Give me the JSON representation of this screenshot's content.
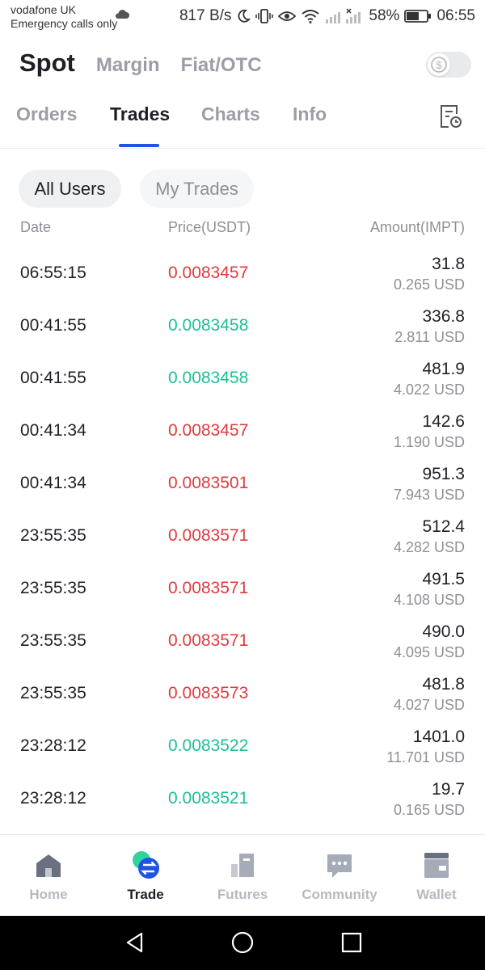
{
  "status_bar": {
    "carrier": "vodafone UK",
    "emergency": "Emergency calls only",
    "speed": "817 B/s",
    "battery": "58%",
    "time": "06:55"
  },
  "top_tabs": [
    "Spot",
    "Margin",
    "Fiat/OTC"
  ],
  "toggle_icon": "dollar-icon",
  "sub_tabs": [
    "Orders",
    "Trades",
    "Charts",
    "Info"
  ],
  "filters": {
    "all": "All Users",
    "mine": "My Trades"
  },
  "table": {
    "headers": {
      "date": "Date",
      "price": "Price(USDT)",
      "amount": "Amount(IMPT)"
    },
    "rows": [
      {
        "time": "06:55:15",
        "price": "0.0083457",
        "amount": "31.8",
        "usd": "0.265 USD",
        "side": "down"
      },
      {
        "time": "00:41:55",
        "price": "0.0083458",
        "amount": "336.8",
        "usd": "2.811 USD",
        "side": "up"
      },
      {
        "time": "00:41:55",
        "price": "0.0083458",
        "amount": "481.9",
        "usd": "4.022 USD",
        "side": "up"
      },
      {
        "time": "00:41:34",
        "price": "0.0083457",
        "amount": "142.6",
        "usd": "1.190 USD",
        "side": "down"
      },
      {
        "time": "00:41:34",
        "price": "0.0083501",
        "amount": "951.3",
        "usd": "7.943 USD",
        "side": "down"
      },
      {
        "time": "23:55:35",
        "price": "0.0083571",
        "amount": "512.4",
        "usd": "4.282 USD",
        "side": "down"
      },
      {
        "time": "23:55:35",
        "price": "0.0083571",
        "amount": "491.5",
        "usd": "4.108 USD",
        "side": "down"
      },
      {
        "time": "23:55:35",
        "price": "0.0083571",
        "amount": "490.0",
        "usd": "4.095 USD",
        "side": "down"
      },
      {
        "time": "23:55:35",
        "price": "0.0083573",
        "amount": "481.8",
        "usd": "4.027 USD",
        "side": "down"
      },
      {
        "time": "23:28:12",
        "price": "0.0083522",
        "amount": "1401.0",
        "usd": "11.701 USD",
        "side": "up"
      },
      {
        "time": "23:28:12",
        "price": "0.0083521",
        "amount": "19.7",
        "usd": "0.165 USD",
        "side": "up"
      }
    ]
  },
  "bottom_nav": [
    {
      "label": "Home",
      "icon": "home-icon"
    },
    {
      "label": "Trade",
      "icon": "trade-icon"
    },
    {
      "label": "Futures",
      "icon": "futures-icon"
    },
    {
      "label": "Community",
      "icon": "community-icon"
    },
    {
      "label": "Wallet",
      "icon": "wallet-icon"
    }
  ],
  "colors": {
    "up": "#1cbf97",
    "down": "#e03a3e",
    "accent": "#1f52e6"
  }
}
